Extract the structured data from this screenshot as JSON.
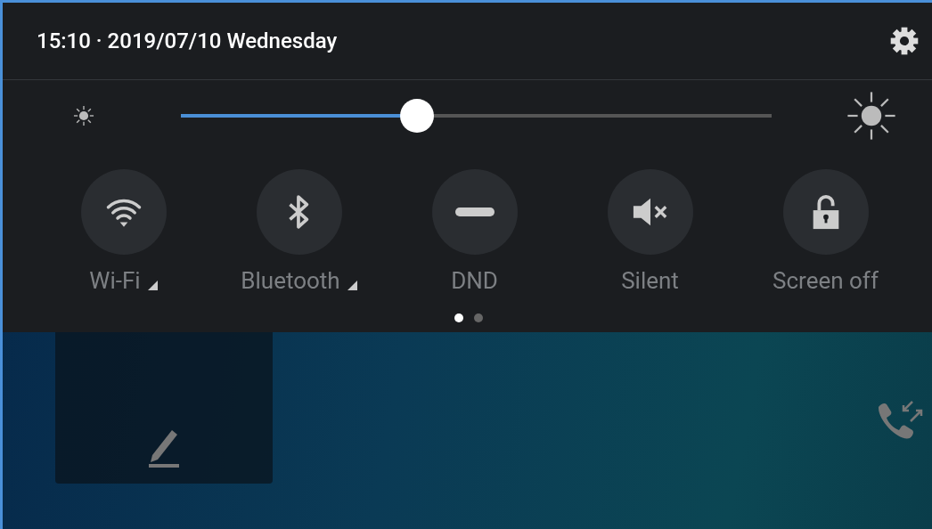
{
  "header": {
    "datetime": "15:10 · 2019/07/10 Wednesday"
  },
  "brightness": {
    "level": 0.4
  },
  "tiles": [
    {
      "kind": "wifi",
      "label": "Wi-Fi",
      "on": false,
      "expandable": true
    },
    {
      "kind": "bluetooth",
      "label": "Bluetooth",
      "on": false,
      "expandable": true
    },
    {
      "kind": "dnd",
      "label": "DND",
      "on": false,
      "expandable": false
    },
    {
      "kind": "silent",
      "label": "Silent",
      "on": false,
      "expandable": false
    },
    {
      "kind": "lock",
      "label": "Screen off",
      "on": false,
      "expandable": false
    }
  ],
  "pages": [
    {
      "selected": true
    },
    {
      "selected": false
    }
  ]
}
